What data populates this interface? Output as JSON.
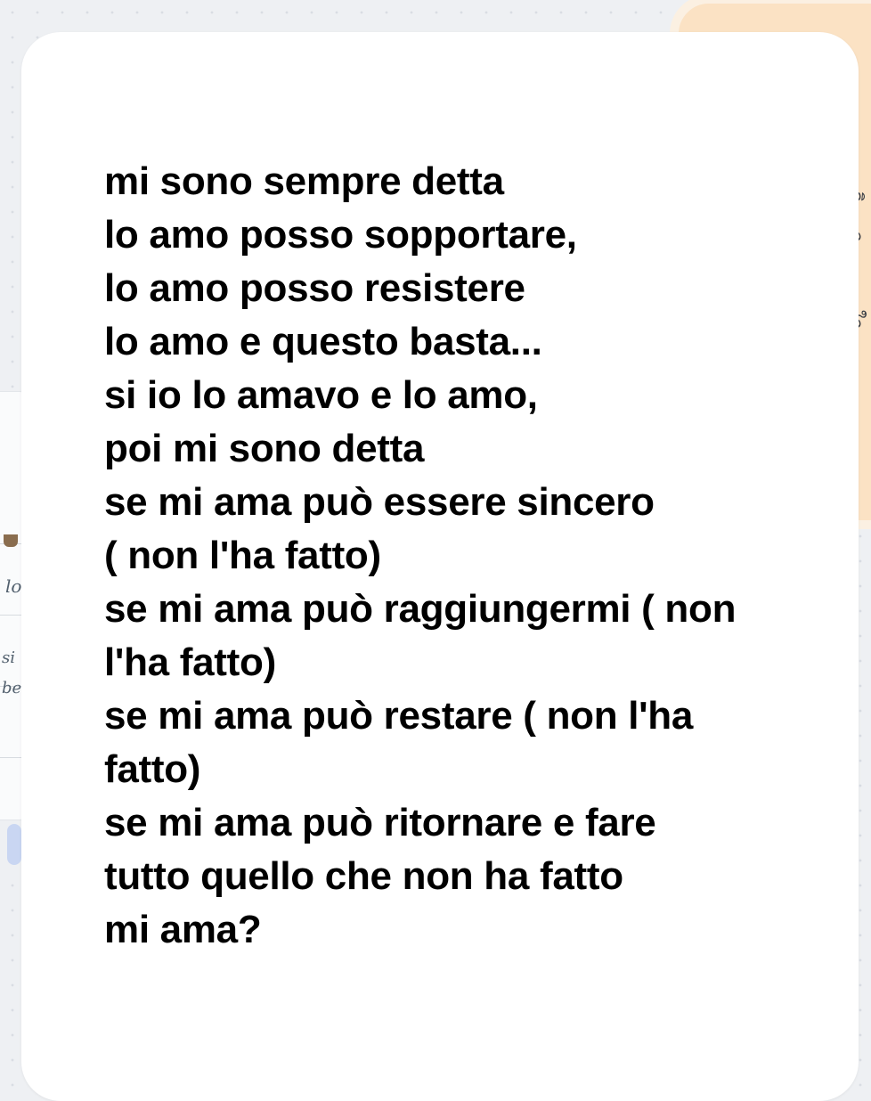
{
  "poem": {
    "lines": [
      "mi sono sempre detta",
      "lo amo posso sopportare,",
      "lo amo posso resistere",
      "lo amo e questo basta...",
      "si io lo amavo e lo amo,",
      "poi mi sono detta",
      "se mi ama può essere sincero",
      "( non l'ha fatto)",
      "se mi ama può raggiungermi ( non",
      "l'ha fatto)",
      "se mi ama può restare ( non l'ha",
      "fatto)",
      "se mi ama può ritornare e fare",
      "tutto quello che non ha fatto",
      "mi ama?"
    ]
  },
  "background": {
    "left_scribbles": [
      "lo",
      "si",
      "be"
    ],
    "right_scribbles": [
      "ดิ",
      "จ",
      "ใจ"
    ]
  },
  "colors": {
    "page_background": "#eef0f3",
    "card_background": "#ffffff",
    "text": "#000000",
    "sticker_peach": "#fbe2c4"
  }
}
